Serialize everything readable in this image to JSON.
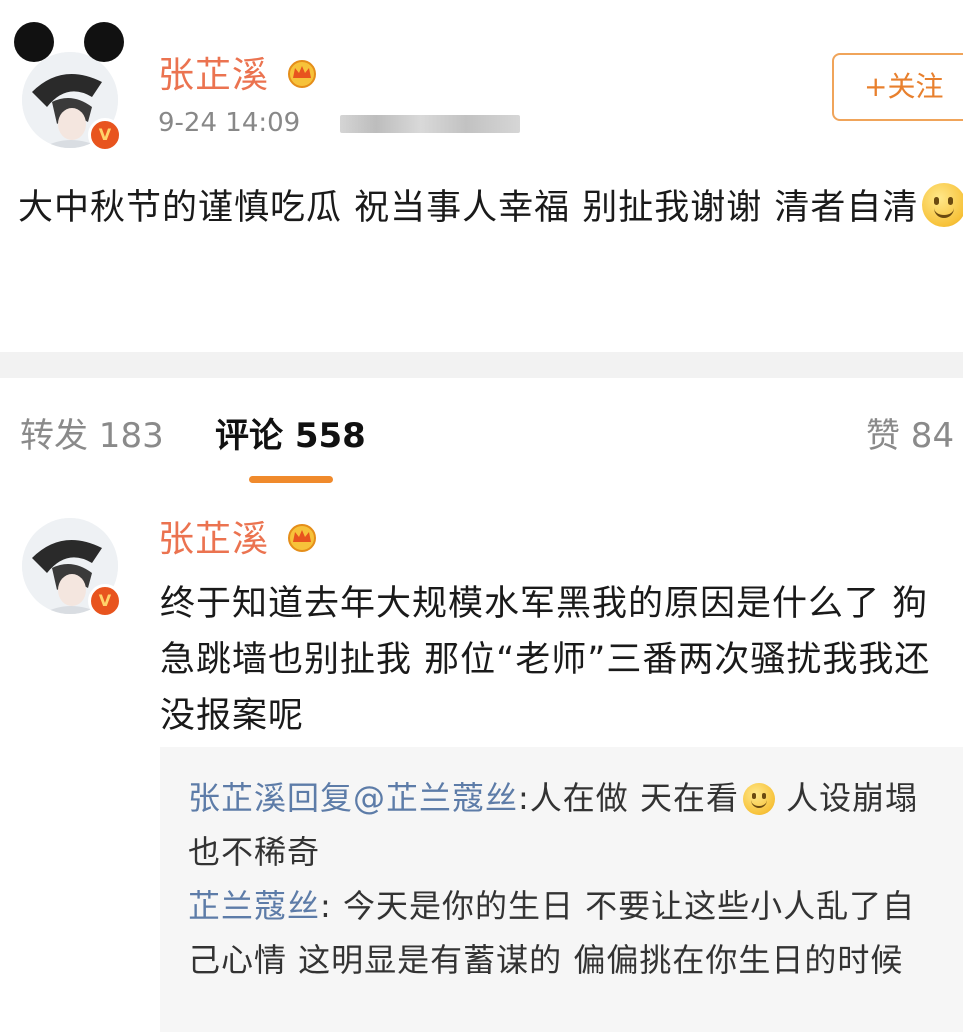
{
  "post": {
    "author": "张芷溪",
    "time": "9-24 14:09",
    "follow_label": "+关注",
    "text": "大中秋节的谨慎吃瓜 祝当事人幸福 别扯我谢谢 清者自清"
  },
  "tabs": {
    "repost": "转发 183",
    "comment": "评论 558",
    "like": "赞 84"
  },
  "comment": {
    "author": "张芷溪",
    "text": "终于知道去年大规模水军黑我的原因是什么了 狗急跳墙也别扯我 那位“老师”三番两次骚扰我我还没报案呢"
  },
  "replies": [
    {
      "who": "张芷溪回复@芷兰蔻丝",
      "text_before_emoji": ":人在做 天在看",
      "text_after_emoji": " 人设崩塌也不稀奇"
    },
    {
      "who": "芷兰蔻丝",
      "text": ": 今天是你的生日  不要让这些小人乱了自己心情  这明显是有蓄谋的  偏偏挑在你生日的时候"
    }
  ],
  "icons": {
    "verified_badge": "V",
    "crown": "crown-icon",
    "smile": "smile-emoji"
  },
  "colors": {
    "name": "#eb7350",
    "follow_border": "#f0a45a",
    "tab_underline": "#f08a2c",
    "reply_name": "#5d7ca8",
    "verified": "#e8541e"
  }
}
